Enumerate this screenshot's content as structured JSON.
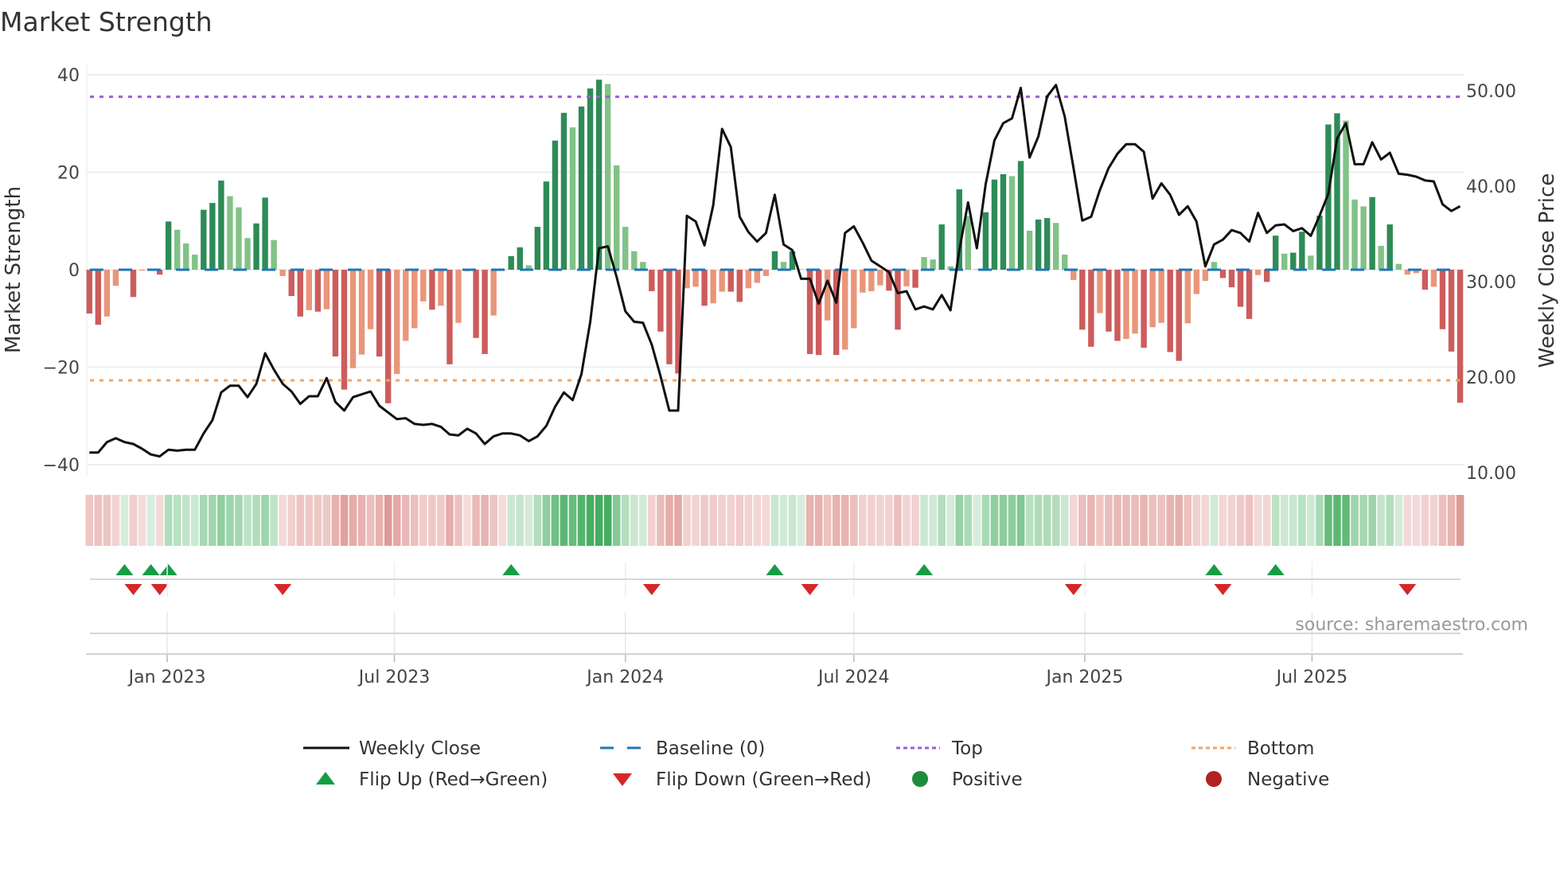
{
  "title": "Market Strength",
  "source": "source: sharemaestro.com",
  "colors": {
    "pos_dark": "#2e8b57",
    "pos_light": "#82c287",
    "neg_dark": "#cd5c5c",
    "neg_light": "#e9967a",
    "baseline": "#1f77b4",
    "top": "#9b5fd6",
    "bottom": "#f2a464",
    "close": "#111111",
    "flip_up": "#169c45",
    "flip_down": "#d62728",
    "positive": "#1e8c3a",
    "negative": "#b22222"
  },
  "legend": [
    {
      "label": "Weekly Close",
      "kind": "line"
    },
    {
      "label": "Baseline (0)",
      "kind": "baseline"
    },
    {
      "label": "Top",
      "kind": "top"
    },
    {
      "label": "Bottom",
      "kind": "bottom"
    },
    {
      "label": "Flip Up (Red→Green)",
      "kind": "up"
    },
    {
      "label": "Flip Down (Green→Red)",
      "kind": "down"
    },
    {
      "label": "Positive",
      "kind": "positive"
    },
    {
      "label": "Negative",
      "kind": "negative"
    }
  ],
  "chart_data": {
    "type": "bar",
    "title": "Market Strength",
    "ylabel": "Market Strength",
    "y2label": "Weekly Close Price",
    "ylim": [
      -40,
      40
    ],
    "y2lim": [
      10,
      50
    ],
    "yticks": [
      "40",
      "20",
      "0",
      "−20",
      "−40"
    ],
    "yticks_values": [
      40,
      20,
      0,
      -20,
      -40
    ],
    "y2ticks": [
      "50.00",
      "40.00",
      "30.00",
      "20.00",
      "10.00"
    ],
    "y2ticks_values": [
      50,
      40,
      30,
      20,
      10
    ],
    "top_level": 35.5,
    "bottom_level": -22.7,
    "start_week": "2022-10-31",
    "xticks": [
      {
        "label": "Jan 2023",
        "date": "2023-01-01"
      },
      {
        "label": "Jul 2023",
        "date": "2023-07-01"
      },
      {
        "label": "Jan 2024",
        "date": "2024-01-01"
      },
      {
        "label": "Jul 2024",
        "date": "2024-07-01"
      },
      {
        "label": "Jan 2025",
        "date": "2025-01-01"
      },
      {
        "label": "Jul 2025",
        "date": "2025-07-01"
      }
    ],
    "series": [
      {
        "name": "Market Strength",
        "type": "bar",
        "values": [
          -9.0,
          -11.3,
          -9.6,
          -3.3,
          0.2,
          -5.6,
          -0.2,
          0.1,
          -1.0,
          9.9,
          8.2,
          5.4,
          3.1,
          12.3,
          13.7,
          18.3,
          15.1,
          12.8,
          6.5,
          9.5,
          14.8,
          6.1,
          -1.3,
          -5.4,
          -9.6,
          -8.3,
          -8.6,
          -8.1,
          -17.8,
          -24.6,
          -20.2,
          -17.4,
          -12.2,
          -17.8,
          -27.4,
          -21.4,
          -14.6,
          -12.0,
          -6.5,
          -8.2,
          -7.4,
          -19.4,
          -10.9,
          -0.3,
          -14.0,
          -17.3,
          -9.4,
          -0.1,
          2.8,
          4.6,
          0.9,
          8.8,
          18.1,
          26.5,
          32.2,
          29.2,
          33.5,
          37.2,
          39.0,
          38.1,
          21.4,
          8.8,
          3.8,
          1.6,
          -4.4,
          -12.7,
          -19.4,
          -21.3,
          -3.8,
          -3.5,
          -7.4,
          -6.9,
          -4.5,
          -4.5,
          -6.6,
          -3.8,
          -2.7,
          -1.3,
          3.8,
          1.6,
          3.8,
          0.1,
          -17.3,
          -17.5,
          -10.4,
          -17.5,
          -16.4,
          -12.0,
          -4.7,
          -4.4,
          -3.2,
          -4.3,
          -12.3,
          -3.4,
          -3.7,
          2.6,
          2.1,
          9.3,
          0.7,
          16.5,
          11.0,
          0.1,
          11.8,
          18.5,
          19.6,
          19.2,
          22.3,
          8.0,
          10.3,
          10.6,
          9.6,
          3.1,
          -2.1,
          -12.3,
          -15.8,
          -8.9,
          -12.7,
          -14.6,
          -14.2,
          -13.1,
          -16.0,
          -11.8,
          -10.9,
          -16.9,
          -18.7,
          -11.0,
          -5.0,
          -2.3,
          1.6,
          -1.7,
          -3.6,
          -7.6,
          -10.1,
          -1.1,
          -2.5,
          7.0,
          3.3,
          3.5,
          7.8,
          2.9,
          11.1,
          29.8,
          32.1,
          30.6,
          14.4,
          13.0,
          14.9,
          4.9,
          9.3,
          1.2,
          -1.0,
          -0.7,
          -4.1,
          -3.5,
          -12.2,
          -16.8,
          -27.3
        ]
      },
      {
        "name": "Weekly Close",
        "type": "line",
        "axis": "right",
        "values": [
          12.1,
          12.1,
          13.2,
          13.6,
          13.2,
          13.0,
          12.5,
          11.9,
          11.7,
          12.4,
          12.3,
          12.4,
          12.4,
          14.1,
          15.5,
          18.4,
          19.1,
          19.1,
          17.9,
          19.3,
          22.5,
          20.8,
          19.3,
          18.5,
          17.2,
          18.0,
          18.0,
          19.9,
          17.4,
          16.5,
          17.9,
          18.2,
          18.5,
          17.0,
          16.3,
          15.6,
          15.7,
          15.1,
          15.0,
          15.1,
          14.8,
          14.0,
          13.9,
          14.6,
          14.1,
          13.0,
          13.8,
          14.1,
          14.1,
          13.9,
          13.3,
          13.8,
          14.9,
          16.9,
          18.4,
          17.6,
          20.3,
          25.8,
          33.5,
          33.7,
          30.5,
          26.9,
          25.8,
          25.7,
          23.4,
          20.1,
          16.5,
          16.5,
          36.9,
          36.3,
          33.8,
          38.0,
          46.0,
          44.1,
          36.8,
          35.2,
          34.2,
          35.1,
          39.1,
          33.9,
          33.3,
          30.3,
          30.3,
          27.7,
          30.1,
          27.8,
          35.1,
          35.8,
          34.1,
          32.2,
          31.6,
          31.0,
          28.8,
          29.0,
          27.1,
          27.4,
          27.1,
          28.6,
          27.0,
          33.3,
          38.3,
          33.5,
          40.2,
          44.8,
          46.6,
          47.1,
          50.3,
          43.0,
          45.2,
          49.4,
          50.6,
          47.3,
          41.9,
          36.4,
          36.8,
          39.6,
          41.9,
          43.4,
          44.4,
          44.4,
          43.6,
          38.7,
          40.3,
          39.1,
          37.0,
          37.9,
          36.3,
          31.6,
          33.9,
          34.4,
          35.4,
          35.1,
          34.2,
          37.2,
          35.1,
          35.9,
          36.0,
          35.3,
          35.6,
          34.8,
          36.9,
          39.2,
          45.0,
          46.6,
          42.3,
          42.3,
          44.6,
          42.8,
          43.5,
          41.3,
          41.2,
          41.0,
          40.6,
          40.5,
          38.1,
          37.4,
          37.9
        ]
      }
    ],
    "flip_up_weeks": [
      5,
      8,
      10,
      49,
      79,
      96,
      129,
      136
    ],
    "flip_down_weeks": [
      6,
      9,
      23,
      65,
      83,
      113,
      130,
      151
    ],
    "legend_position": "bottom"
  }
}
